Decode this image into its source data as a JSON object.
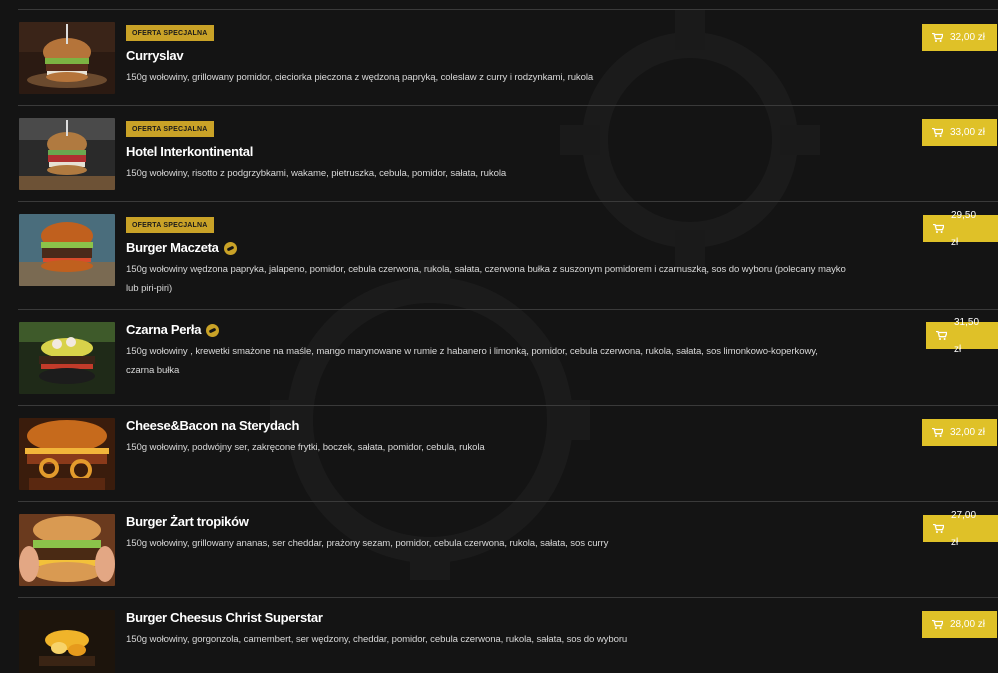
{
  "currency_note": "zł",
  "colors": {
    "accent": "#dfc128",
    "badge": "#c9a227",
    "background": "#141414"
  },
  "items": [
    {
      "badge": "OFERTA SPECJALNA",
      "title": "Curryslav",
      "spicy": false,
      "desc": "150g wołowiny, grillowany pomidor, cieciorka pieczona z wędzoną papryką, coleslaw z curry i rodzynkami, rukola",
      "price": "32,00 zł",
      "image": "burger-photo"
    },
    {
      "badge": "OFERTA SPECJALNA",
      "title": "Hotel Interkontinental",
      "spicy": false,
      "desc": "150g wołowiny, risotto z podgrzybkami, wakame, pietruszka, cebula, pomidor, sałata, rukola",
      "price": "33,00 zł",
      "image": "burger-photo"
    },
    {
      "badge": "OFERTA SPECJALNA",
      "title": "Burger Maczeta",
      "spicy": true,
      "desc": "150g wołowiny wędzona papryka, jalapeno, pomidor, cebula czerwona, rukola, sałata, czerwona bułka z suszonym pomidorem i czarnuszką, sos do wyboru (polecany mayko lub piri-piri)",
      "price": "29,50 zł",
      "image": "burger-photo"
    },
    {
      "badge": "",
      "title": "Czarna Perła",
      "spicy": true,
      "desc": "150g wołowiny , krewetki smażone na maśle, mango marynowane w rumie z habanero i limonką, pomidor, cebula czerwona, rukola, sałata, sos limonkowo-koperkowy, czarna bułka",
      "price": "31,50 zł",
      "image": "burger-photo"
    },
    {
      "badge": "",
      "title": "Cheese&Bacon na Sterydach",
      "spicy": false,
      "desc": "150g wołowiny, podwójny ser, zakręcone frytki, boczek, sałata, pomidor, cebula, rukola",
      "price": "32,00 zł",
      "image": "burger-photo"
    },
    {
      "badge": "",
      "title": "Burger Żart tropików",
      "spicy": false,
      "desc": "150g wołowiny, grillowany ananas, ser cheddar, prażony sezam, pomidor, cebula czerwona, rukola, sałata, sos curry",
      "price": "27,00 zł",
      "image": "burger-photo"
    },
    {
      "badge": "",
      "title": "Burger Cheesus Christ Superstar",
      "spicy": false,
      "desc": "150g wołowiny, gorgonzola, camembert, ser wędzony, cheddar, pomidor, cebula czerwona, rukola, sałata, sos do wyboru",
      "price": "28,00 zł",
      "image": "burger-photo"
    }
  ]
}
